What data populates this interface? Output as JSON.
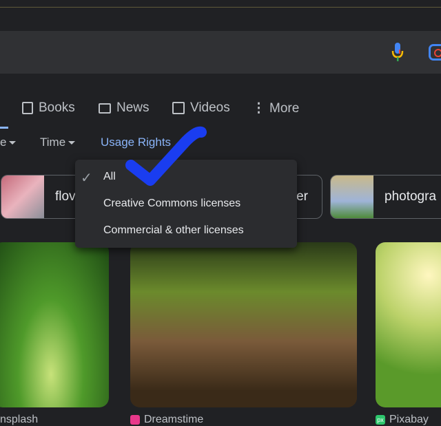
{
  "tabs": [
    {
      "label": "Books",
      "icon": "book-icon"
    },
    {
      "label": "News",
      "icon": "news-icon"
    },
    {
      "label": "Videos",
      "icon": "play-icon"
    },
    {
      "label": "More",
      "icon": "more-vert-icon"
    }
  ],
  "filters": {
    "partial": "e",
    "time": "Time",
    "usage": "Usage Rights"
  },
  "chips": [
    {
      "label": "flov"
    },
    {
      "label": "er"
    },
    {
      "label": "photogra"
    }
  ],
  "menu": {
    "items": [
      {
        "label": "All",
        "selected": true
      },
      {
        "label": "Creative Commons licenses"
      },
      {
        "label": "Commercial & other licenses"
      }
    ]
  },
  "results": [
    {
      "source": "nsplash"
    },
    {
      "source": "Dreamstime",
      "favicon_color": "#e8388a"
    },
    {
      "source": "Pixabay",
      "favicon_color": "#2ec66d",
      "favicon_text": "px"
    }
  ],
  "colors": {
    "accent": "#8ab4f8",
    "annotation": "#1a3df0"
  }
}
